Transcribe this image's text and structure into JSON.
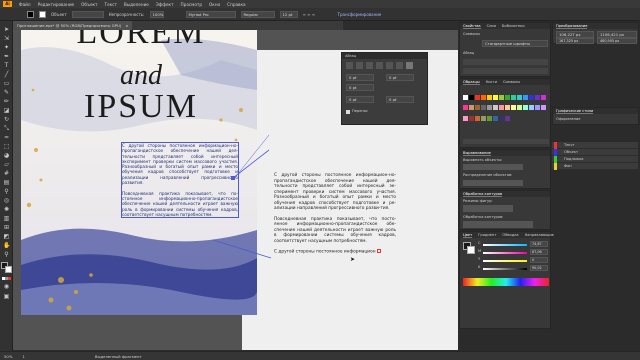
{
  "app": {
    "logo": "Ai"
  },
  "menu": [
    "Файл",
    "Редактирование",
    "Объект",
    "Текст",
    "Выделение",
    "Эффект",
    "Просмотр",
    "Окно",
    "Справка"
  ],
  "control": {
    "label_object": "Объект",
    "opacity_label": "Непрозрачность:",
    "opacity_value": "100%",
    "font_name": "Myriad Pro",
    "font_style": "Regular",
    "font_size": "12 pt",
    "transform_label": "Трансформирование"
  },
  "document_tab": {
    "title": "Приглашение.eps* @ 50% (RGB/Предпросмотр GPU)",
    "close": "×"
  },
  "artboard": {
    "title_line1": "LOREM",
    "title_line2": "and",
    "title_line3": "IPSUM",
    "body1": "С другой стороны постоянное информацион-но-пропагандистское обеспечение нашей дея-тельности представляет собой интересный эксперимент проверки систем массового участия. Разнообразный и богатый опыт рамки и место обучения кадров способствует подготовке и реализации направлений прогрессивно-го развития.\n\nПовседневная практика показывает, что по-стоянное информационно-пропагандистское обеспечение нашей деятельности играет важную роль в формировании системы обучения кадров, соответствует насущным потребностям."
  },
  "pasteboard_text": {
    "para1": "С другой стороны постоянное информацион-но-пропагандистское обеспечение нашей дея-тельности представляет собой интересный эк-сперимент проверки систем массового участия. Разнообразный и богатый опыт рамки и место обучения кадров способствует подготовке и ре-ализации направлений прогрессивного разви-тия.",
    "para2": "Повседневная практика показывает, что посто-янное информационно-пропагандистское обе-спечение нашей деятельности играет важную роль в формировании системы обучения кадров, соответствует насущным потребностям.",
    "para3": "С другой стороны постоянное информацион"
  },
  "float_panel": {
    "title": "Абзац",
    "field1": "0 pt",
    "field2": "0 pt",
    "field3": "0 pt",
    "field4": "0 pt",
    "field5": "0 pt",
    "hyphenation_label": "Перенос"
  },
  "right": {
    "properties_tabs": [
      "Свойства",
      "Слои",
      "Библиотеки"
    ],
    "character_label": "Символы",
    "paragraph_label": "Абзац",
    "swatch_tabs": [
      "Образцы",
      "Кисти",
      "Символы"
    ],
    "transparency_label": "Обычные",
    "align_label": "Выравнивание",
    "align_to_label": "Выровнять объекты:",
    "distribute_label": "Распределение объектов:",
    "pathfinder_label": "Обработка контуров",
    "pathfinder_shape_label": "Режимы фигур:",
    "pathfinder_ops_label": "Обработка контуров:",
    "color_tabs": [
      "Цвет",
      "Градиент",
      "Обводка",
      "Направляющие"
    ],
    "color_values": [
      "74,67",
      "67,06",
      "0",
      "90,02"
    ],
    "color_channels": [
      "C",
      "M",
      "Y",
      "K"
    ],
    "right_top_fields": [
      "106,227 px",
      "167,325 px",
      "1106,421 px",
      "480,905 px"
    ],
    "right_top_title": "Преобразование",
    "layer_items": [
      "Текст",
      "Объект",
      "Подложка",
      "Фон"
    ],
    "graphic_styles_label": "Графические стили",
    "appearance_label": "Оформление",
    "standard_label": "Стандартные шрифты"
  },
  "status": {
    "zoom": "50%",
    "page": "1",
    "tool": "Выделенный фрагмент"
  },
  "colors": {
    "accent": "#ff9a00",
    "selection": "#4c5bd4",
    "text_blue": "#1d2c72"
  }
}
